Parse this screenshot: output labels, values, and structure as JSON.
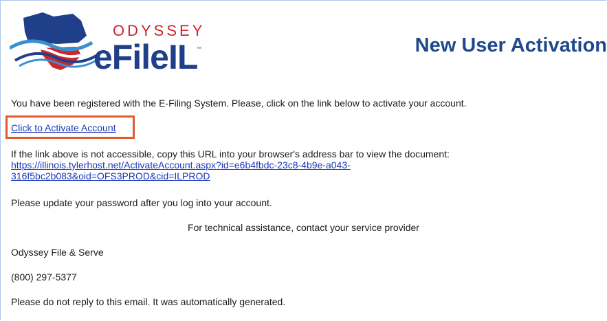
{
  "header": {
    "logo": {
      "brand_top": "ODYSSEY",
      "brand_main": "eFileIL",
      "trademark": "™",
      "colors": {
        "red": "#c8282e",
        "blue": "#1f3f8a",
        "wave": "#3a8fd0"
      }
    },
    "title": "New User Activation",
    "title_color": "#1f4a8a"
  },
  "body": {
    "intro": "You have been registered with the E-Filing System. Please, click on the link below to activate your account.",
    "activate_link": "Click to Activate Account",
    "highlight_color": "#e05a2b",
    "fallback_text": "If the link above is not accessible, copy this URL into your browser's address bar to view the document:",
    "url_line1": "https://illinois.tylerhost.net/ActivateAccount.aspx?id=e6b4fbdc-23c8-4b9e-a043-",
    "url_line2": "316f5bc2b083&oid=OFS3PROD&cid=ILPROD",
    "password_note": "Please update your password after you log into your account.",
    "tech_assistance": "For technical assistance, contact your service provider",
    "signature": "Odyssey File & Serve",
    "phone": "(800) 297-5377",
    "no_reply": "Please do not reply to this email. It was automatically generated."
  }
}
